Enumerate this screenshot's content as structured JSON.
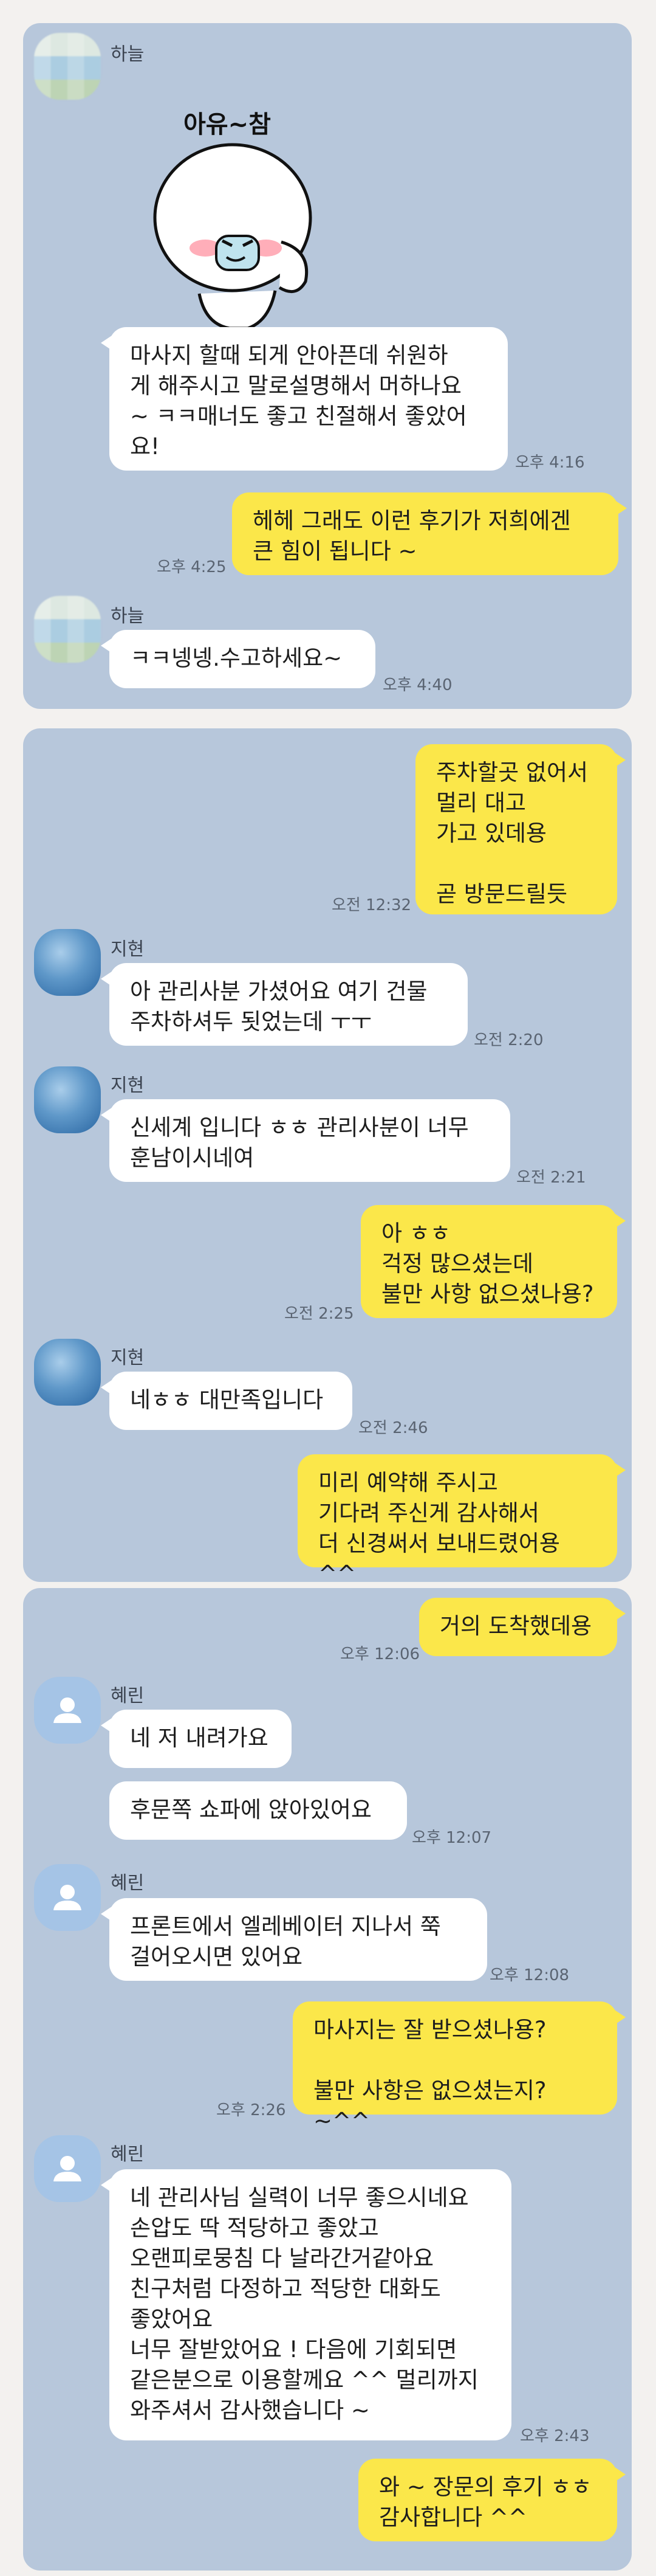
{
  "chat1": {
    "sender_name": "하늘",
    "sticker_text": "아유~참",
    "msg1": "마사지 할때 되게 안아픈데 쉬원하\n게 해주시고 말로설명해서 머하나요\n~ ㅋㅋ매너도 좋고 친절해서 좋았어\n요!",
    "msg1_time": "오후 4:16",
    "reply1": "헤헤 그래도 이런 후기가 저희에겐\n큰 힘이 됩니다 ~",
    "reply1_time": "오후 4:25",
    "msg2": "ㅋㅋ넹넹.수고하세요~",
    "msg2_time": "오후 4:40"
  },
  "chat2": {
    "sender_name": "지현",
    "out1": "주차할곳 없어서\n멀리 대고\n가고 있데용\n\n곧 방문드릴듯",
    "out1_time": "오전 12:32",
    "in1": "아 관리사분 가셨어요 여기 건물\n주차하셔두 됫었는데 ㅜㅜ",
    "in1_time": "오전 2:20",
    "in2": "신세계 입니다 ㅎㅎ 관리사분이 너무\n훈남이시네여",
    "in2_time": "오전 2:21",
    "out2": "아 ㅎㅎ\n걱정 많으셨는데\n불만 사항 없으셨나용?",
    "out2_time": "오전 2:25",
    "in3": "네ㅎㅎ 대만족입니다",
    "in3_time": "오전 2:46",
    "out3": "미리 예약해 주시고\n기다려 주신게 감사해서\n더 신경써서 보내드렸어용 ^^"
  },
  "chat3": {
    "sender_name": "혜린",
    "out1": "거의 도착했데용",
    "out1_time": "오후 12:06",
    "in1": "네 저 내려가요",
    "in2": "후문쪽 쇼파에 앉아있어요",
    "in2_time": "오후 12:07",
    "in3": "프론트에서 엘레베이터 지나서 쭉\n걸어오시면 있어요",
    "in3_time": "오후 12:08",
    "out2": "마사지는 잘 받으셨나용?\n\n불만 사항은 없으셨는지? ~^^",
    "out2_time": "오후 2:26",
    "in4": "네 관리사님 실력이 너무 좋으시네요\n손압도 딱 적당하고 좋았고\n오랜피로뭉침 다 날라간거같아요\n친구처럼 다정하고 적당한 대화도\n좋았어요\n너무 잘받았어요 ! 다음에 기회되면\n같은분으로 이용할께요 ^^ 멀리까지\n와주셔서 감사했습니다 ~",
    "in4_time": "오후 2:43",
    "out3": "와 ~ 장문의 후기 ㅎㅎ\n감사합니다 ^^"
  }
}
